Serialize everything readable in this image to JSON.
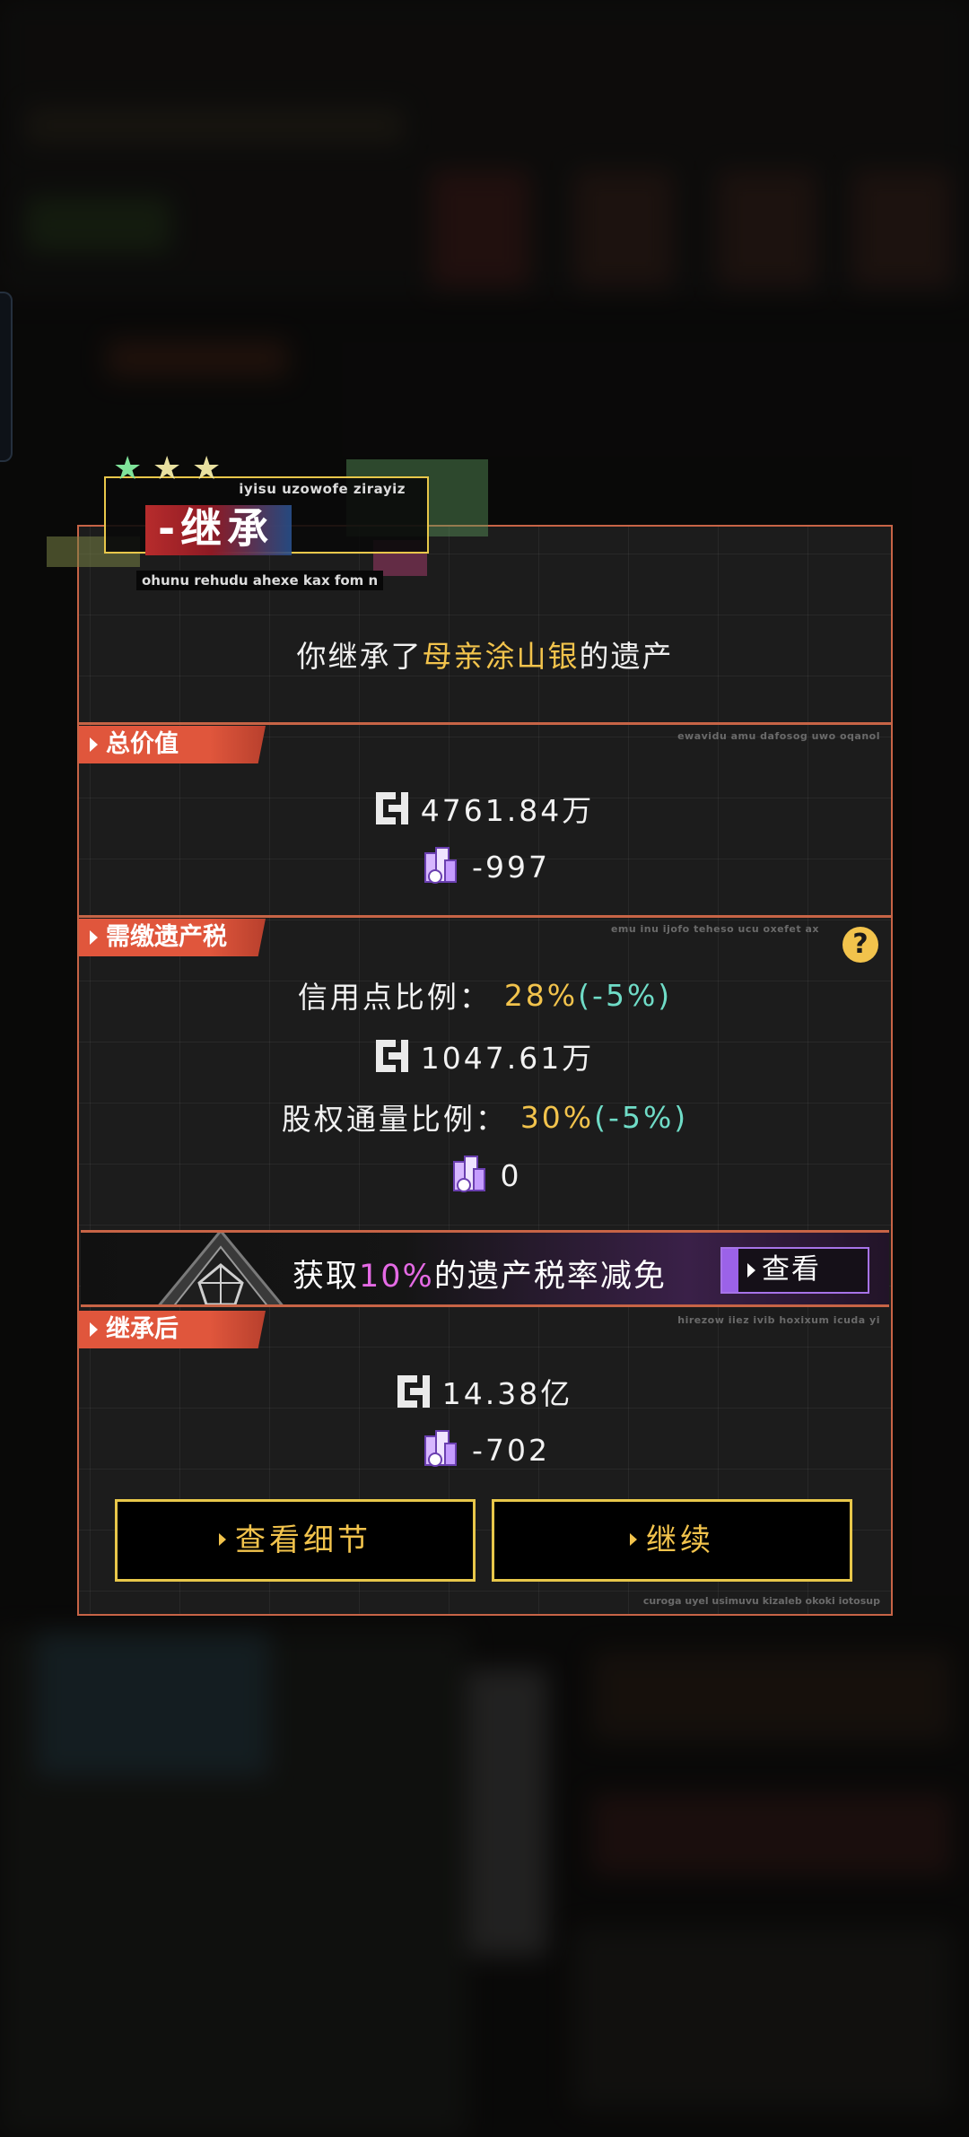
{
  "badge": {
    "stars": [
      "★",
      "★",
      "★"
    ],
    "top_text": "iyisu uzowofe zirayiz",
    "title": "-继承",
    "subtitle": "ohunu rehudu ahexe kax fom n"
  },
  "inheritance": {
    "prefix": "你继承了",
    "source": "母亲涂山银",
    "suffix": "的遗产"
  },
  "total_value": {
    "tab_label": "总价值",
    "tag": "ewavidu amu dafosog uwo oqanol",
    "money": "4761.84万",
    "chips": "-997"
  },
  "tax": {
    "tab_label": "需缴遗产税",
    "tag": "emu inu ijofo teheso ucu oxefet ax",
    "help": "?",
    "credit_ratio_label": "信用点比例：",
    "credit_ratio_value": "28%",
    "credit_ratio_delta": "(-5%)",
    "money": "1047.61万",
    "equity_ratio_label": "股权通量比例：",
    "equity_ratio_value": "30%",
    "equity_ratio_delta": "(-5%)",
    "chips": "0"
  },
  "promo": {
    "prefix": "获取",
    "highlight": "10%",
    "suffix": "的遗产税率减免",
    "button": "查看"
  },
  "after": {
    "tab_label": "继承后",
    "tag": "hirezow iiez ivib hoxixum icuda yi",
    "money": "14.38亿",
    "chips": "-702"
  },
  "actions": {
    "details": "查看细节",
    "continue": "继续"
  },
  "footer_tag": "curoga uyel usimuvu kizaleb okoki iotosup",
  "colors": {
    "accent_orange": "#c76446",
    "gold": "#f2c34c",
    "teal": "#6fdcc7",
    "pink": "#e46ae4",
    "purple": "#a773e8"
  },
  "icons": {
    "money": "money-glyph-icon",
    "chip": "chip-stack-icon",
    "help": "question-icon",
    "arrow": "play-arrow-icon"
  }
}
